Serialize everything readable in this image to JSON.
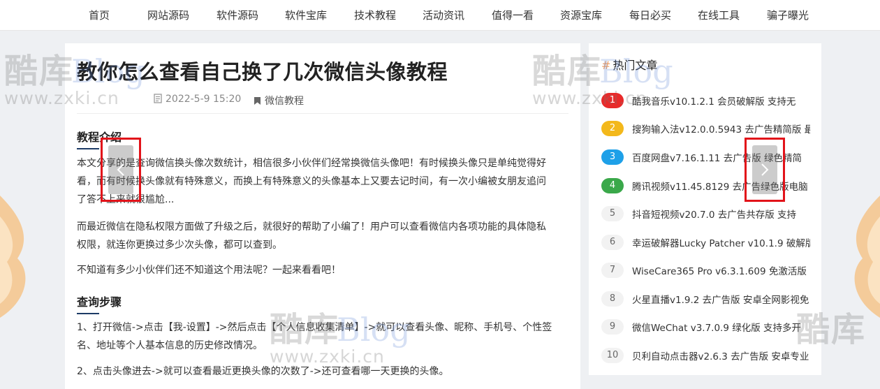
{
  "nav": {
    "items": [
      "首页",
      "网站源码",
      "软件源码",
      "软件宝库",
      "技术教程",
      "活动资讯",
      "值得一看",
      "资源宝库",
      "每日必买",
      "在线工具",
      "骗子曝光"
    ]
  },
  "article": {
    "title": "教你怎么查看自己换了几次微信头像教程",
    "date": "2022-5-9 15:20",
    "category": "微信教程",
    "section1": "教程介绍",
    "p1": [
      "本文分享的是查询微信换头像次数统计，相信很多小伙伴们经常换微信头像吧！有时候换头像只是单纯觉得好",
      "看，而有时候换头像就有特殊意义，而换上有特殊意义的头像基本上又要去记时间，有一次小编被女朋友追问",
      "了答不上来就很尴尬..."
    ],
    "p2": [
      "而最近微信在隐私权限方面做了升级之后，就很好的帮助了小编了！用户可以查看微信内各项功能的具体隐私",
      "权限，就连你更换过多少次头像，都可以查到。"
    ],
    "p3": [
      "不知道有多少小伙伴们还不知道这个用法呢？一起来看看吧！"
    ],
    "section2": "查询步骤",
    "p4": [
      "1、打开微信->点击【我-设置】->然后点击【个人信息收集清单】->就可以查看头像、昵称、手机号、个性签",
      "名、地址等个人基本信息的历史修改情况。"
    ],
    "p5": [
      "2、点击头像进去->就可以查看最近更换头像的次数了->还可查看哪一天更换的头像。"
    ]
  },
  "watermark": {
    "cn": "酷库",
    "blog": "Blog",
    "url": "www.zxki.cn"
  },
  "sidebar": {
    "hash": "#",
    "title": "热门文章",
    "items": [
      {
        "rank": "1",
        "text": "酷我音乐v10.1.2.1 会员破解版 支持无",
        "color": "#e82a2a"
      },
      {
        "rank": "2",
        "text": "搜狗输入法v12.0.0.5943 去广告精简版 最",
        "color": "#f3b81b"
      },
      {
        "rank": "3",
        "text": "百度网盘v7.16.1.11 去广告版 绿色精简",
        "color": "#1ea0e8"
      },
      {
        "rank": "4",
        "text": "腾讯视频v11.45.8129 去广告绿色版电脑",
        "color": "#3aa84a"
      },
      {
        "rank": "5",
        "text": "抖音短视频v20.7.0 去广告共存版 支持"
      },
      {
        "rank": "6",
        "text": "幸运破解器Lucky Patcher v10.1.9 破解版"
      },
      {
        "rank": "7",
        "text": "WiseCare365 Pro v6.3.1.609 免激活版"
      },
      {
        "rank": "8",
        "text": "火星直播v1.9.2 去广告版 安卓全网影视免"
      },
      {
        "rank": "9",
        "text": "微信WeChat v3.7.0.9 绿化版 支持多开"
      },
      {
        "rank": "10",
        "text": "贝利自动点击器v2.6.3 去广告版 安卓专业"
      }
    ]
  }
}
